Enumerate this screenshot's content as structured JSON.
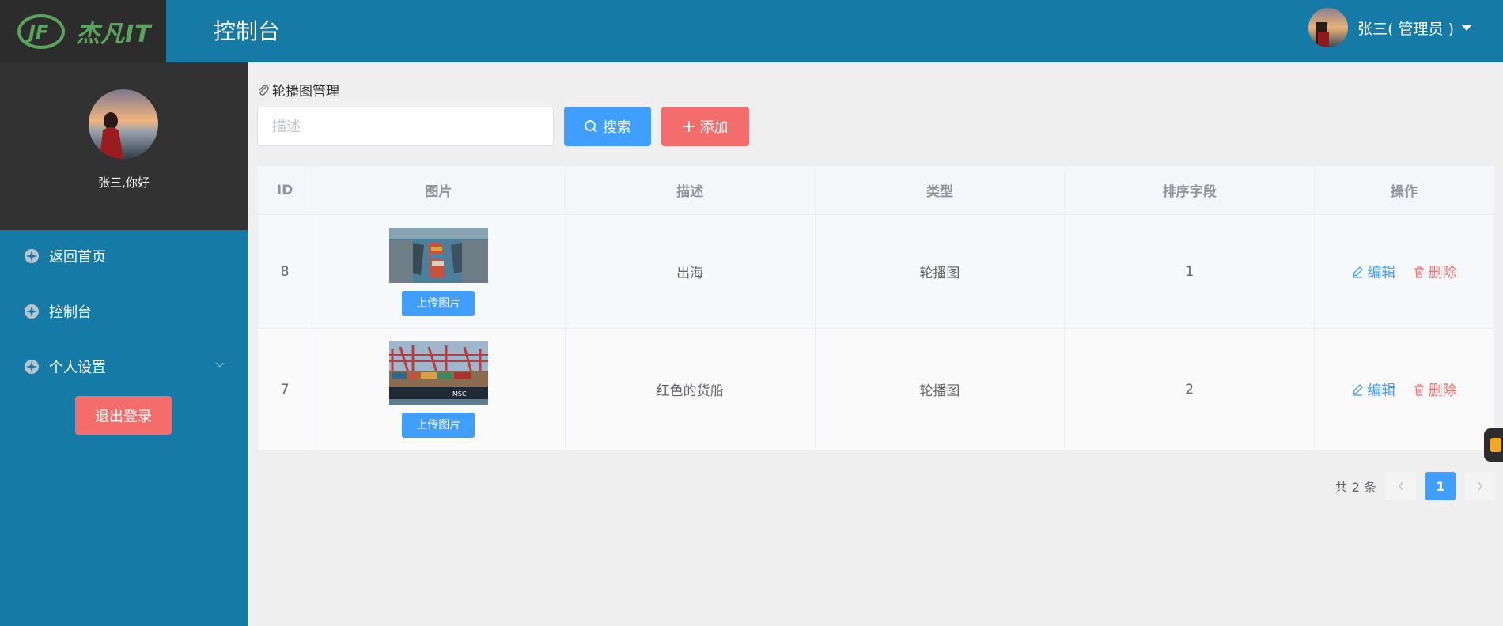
{
  "header": {
    "logo_text": "杰凡IT",
    "title": "控制台",
    "user_label": "张三( 管理员 )"
  },
  "sidebar": {
    "greeting": "张三,你好",
    "items": [
      {
        "label": "返回首页"
      },
      {
        "label": "控制台"
      },
      {
        "label": "个人设置"
      }
    ],
    "logout_label": "退出登录"
  },
  "main": {
    "breadcrumb": "轮播图管理",
    "search_placeholder": "描述",
    "search_button": "搜索",
    "add_button": "添加"
  },
  "table": {
    "columns": [
      "ID",
      "图片",
      "描述",
      "类型",
      "排序字段",
      "操作"
    ],
    "rows": [
      {
        "id": "8",
        "description": "出海",
        "type": "轮播图",
        "sort": "1",
        "upload_label": "上传图片",
        "edit_label": "编辑",
        "delete_label": "删除"
      },
      {
        "id": "7",
        "description": "红色的货船",
        "type": "轮播图",
        "sort": "2",
        "upload_label": "上传图片",
        "edit_label": "编辑",
        "delete_label": "删除"
      }
    ]
  },
  "pagination": {
    "total_text": "共 2 条",
    "current_page": "1"
  },
  "colors": {
    "header_bg": "#157aa6",
    "logo_bg": "#2c2c2c",
    "profile_bg": "#323232",
    "primary": "#409eff",
    "danger": "#f56c6c"
  },
  "icons": {
    "logo": "jf-logo-icon",
    "menu": "circle-menu-icon",
    "search": "search-icon",
    "add": "plus-icon",
    "edit": "edit-icon",
    "delete": "trash-icon",
    "breadcrumb": "paperclip-icon"
  }
}
